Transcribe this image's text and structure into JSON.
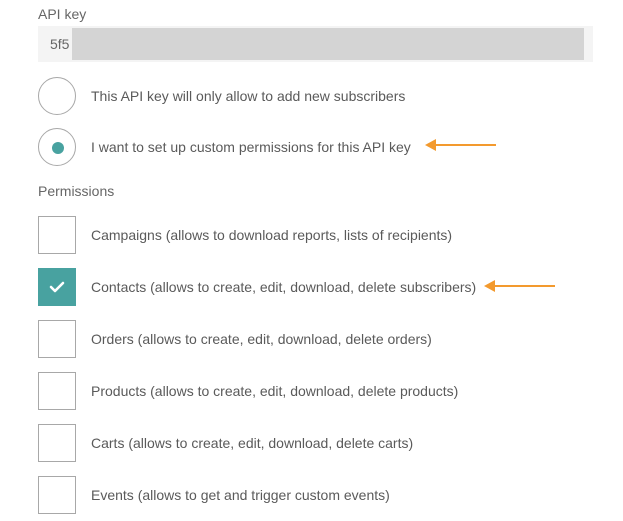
{
  "api_key": {
    "label": "API key",
    "visible_value": "5f5"
  },
  "access_mode": {
    "options": [
      {
        "label": "This API key will only allow to add new subscribers",
        "selected": false
      },
      {
        "label": "I want to set up custom permissions for this API key",
        "selected": true
      }
    ]
  },
  "permissions": {
    "label": "Permissions",
    "items": [
      {
        "label": "Campaigns (allows to download reports, lists of recipients)",
        "checked": false
      },
      {
        "label": "Contacts (allows to create, edit, download, delete subscribers)",
        "checked": true
      },
      {
        "label": "Orders (allows to create, edit, download, delete orders)",
        "checked": false
      },
      {
        "label": "Products (allows to create, edit, download, delete products)",
        "checked": false
      },
      {
        "label": "Carts (allows to create, edit, download, delete carts)",
        "checked": false
      },
      {
        "label": "Events (allows to get and trigger custom events)",
        "checked": false
      }
    ]
  },
  "colors": {
    "accent": "#48a2a0",
    "annotation_arrow": "#f39a2e",
    "masked_key": "#d4d4d4"
  },
  "icons": {
    "checkmark": "checkmark-icon",
    "annotation": "arrow-left-icon"
  }
}
